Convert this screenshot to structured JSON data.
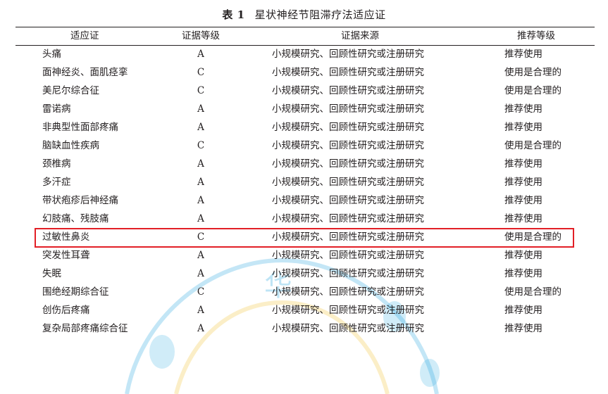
{
  "table": {
    "title_label": "表 1",
    "title_text": "星状神经节阻滞疗法适应证",
    "headers": [
      "适应证",
      "证据等级",
      "证据来源",
      "推荐等级"
    ],
    "rows": [
      {
        "indication": "头痛",
        "level": "A",
        "source": "小规模研究、回顾性研究或注册研究",
        "recommendation": "推荐使用"
      },
      {
        "indication": "面神经炎、面肌痉挛",
        "level": "C",
        "source": "小规模研究、回顾性研究或注册研究",
        "recommendation": "使用是合理的"
      },
      {
        "indication": "美尼尔综合征",
        "level": "C",
        "source": "小规模研究、回顾性研究或注册研究",
        "recommendation": "使用是合理的"
      },
      {
        "indication": "雷诺病",
        "level": "A",
        "source": "小规模研究、回顾性研究或注册研究",
        "recommendation": "推荐使用"
      },
      {
        "indication": "非典型性面部疼痛",
        "level": "A",
        "source": "小规模研究、回顾性研究或注册研究",
        "recommendation": "推荐使用"
      },
      {
        "indication": "脑缺血性疾病",
        "level": "C",
        "source": "小规模研究、回顾性研究或注册研究",
        "recommendation": "使用是合理的"
      },
      {
        "indication": "颈椎病",
        "level": "A",
        "source": "小规模研究、回顾性研究或注册研究",
        "recommendation": "推荐使用"
      },
      {
        "indication": "多汗症",
        "level": "A",
        "source": "小规模研究、回顾性研究或注册研究",
        "recommendation": "推荐使用"
      },
      {
        "indication": "带状疱疹后神经痛",
        "level": "A",
        "source": "小规模研究、回顾性研究或注册研究",
        "recommendation": "推荐使用"
      },
      {
        "indication": "幻肢痛、残肢痛",
        "level": "A",
        "source": "小规模研究、回顾性研究或注册研究",
        "recommendation": "推荐使用"
      },
      {
        "indication": "过敏性鼻炎",
        "level": "C",
        "source": "小规模研究、回顾性研究或注册研究",
        "recommendation": "使用是合理的"
      },
      {
        "indication": "突发性耳聋",
        "level": "A",
        "source": "小规模研究、回顾性研究或注册研究",
        "recommendation": "推荐使用"
      },
      {
        "indication": "失眠",
        "level": "A",
        "source": "小规模研究、回顾性研究或注册研究",
        "recommendation": "推荐使用"
      },
      {
        "indication": "围绝经期综合征",
        "level": "C",
        "source": "小规模研究、回顾性研究或注册研究",
        "recommendation": "使用是合理的"
      },
      {
        "indication": "创伤后疼痛",
        "level": "A",
        "source": "小规模研究、回顾性研究或注册研究",
        "recommendation": "推荐使用"
      },
      {
        "indication": "复杂局部疼痛综合征",
        "level": "A",
        "source": "小规模研究、回顾性研究或注册研究",
        "recommendation": "推荐使用"
      }
    ],
    "highlighted_row_index": 10
  },
  "watermark": {
    "char": "华",
    "color_blue": "#2aa7e0",
    "color_yellow": "#f3c43a"
  },
  "colors": {
    "highlight": "#e21f26",
    "text": "#231f20"
  }
}
